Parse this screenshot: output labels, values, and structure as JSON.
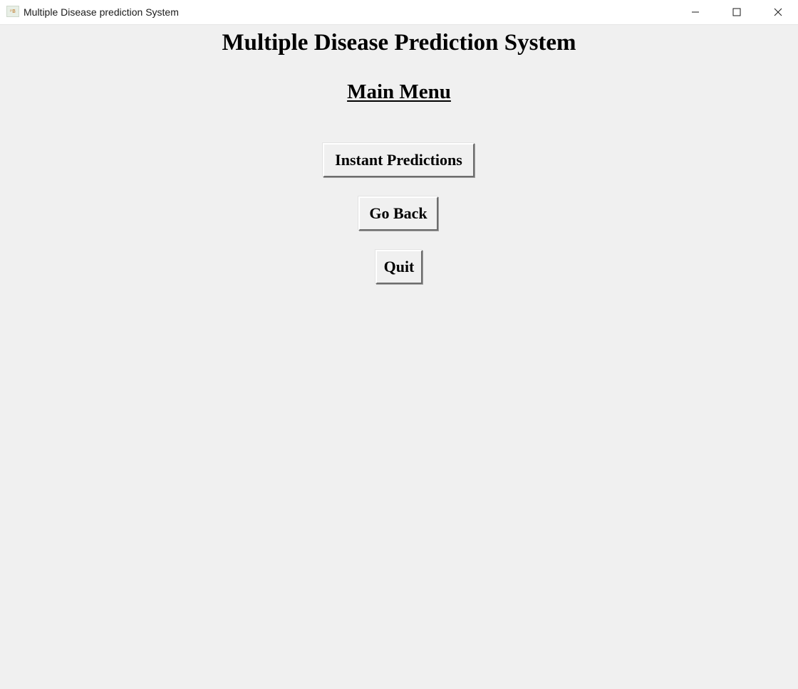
{
  "window": {
    "title": "Multiple Disease prediction System",
    "icon": "app-icon"
  },
  "window_controls": {
    "minimize_icon": "minimize-icon",
    "maximize_icon": "maximize-icon",
    "close_icon": "close-icon"
  },
  "main": {
    "heading": "Multiple Disease Prediction System",
    "subheading": "Main Menu",
    "buttons": {
      "instant_predictions": "Instant Predictions",
      "go_back": "Go Back",
      "quit": "Quit"
    }
  },
  "colors": {
    "background": "#f0f0f0",
    "titlebar": "#ffffff",
    "text": "#000000"
  }
}
